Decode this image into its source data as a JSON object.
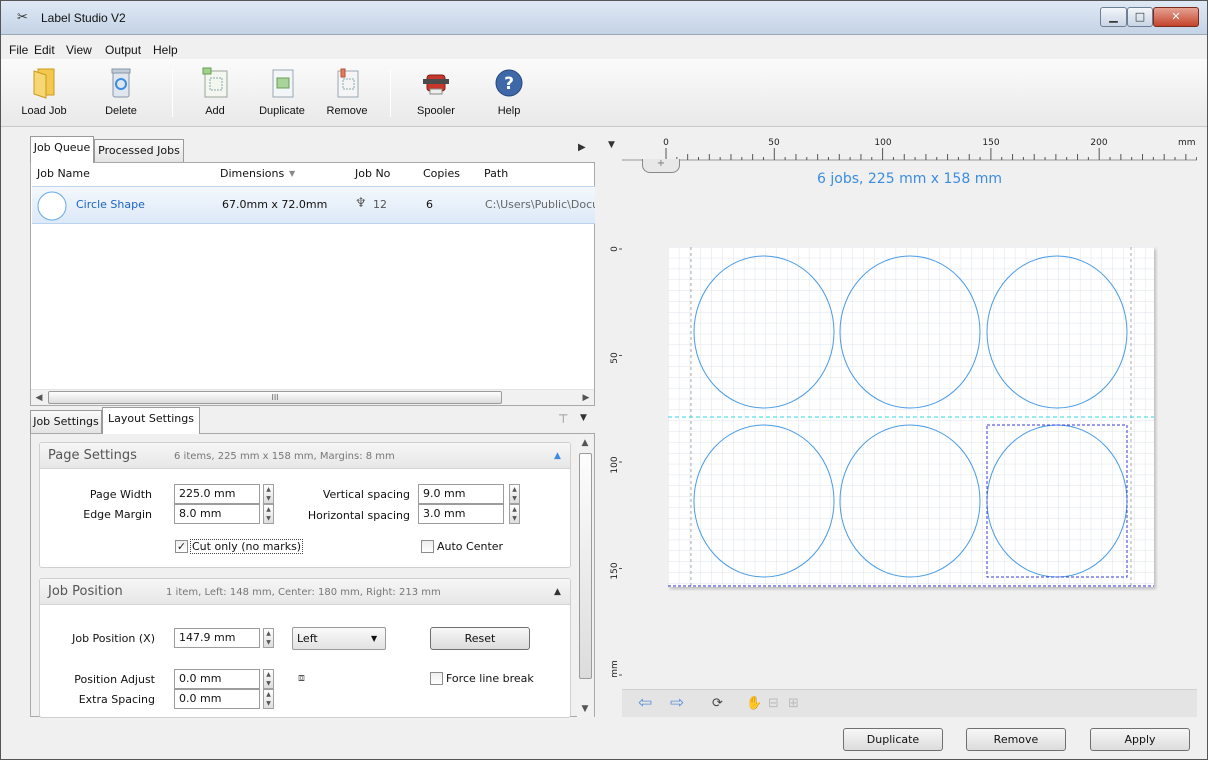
{
  "window": {
    "title": "Label Studio V2",
    "min_glyph": "▁",
    "max_glyph": "□",
    "close_glyph": "✕"
  },
  "menu": [
    {
      "label": "File"
    },
    {
      "label": "Edit"
    },
    {
      "label": "View"
    },
    {
      "label": "Output"
    },
    {
      "label": "Help"
    }
  ],
  "toolbar": {
    "load_job": "Load Job",
    "delete": "Delete",
    "add": "Add",
    "duplicate": "Duplicate",
    "remove": "Remove",
    "spooler": "Spooler",
    "help": "Help"
  },
  "job_tabs": {
    "queue": "Job Queue",
    "processed": "Processed Jobs"
  },
  "job_table": {
    "columns": {
      "name": "Job Name",
      "dimensions": "Dimensions",
      "job_no": "Job No",
      "copies": "Copies",
      "path": "Path"
    },
    "rows": [
      {
        "name": "Circle Shape",
        "dimensions": "67.0mm x 72.0mm",
        "job_no": "12",
        "copies": "6",
        "path": "C:\\Users\\Public\\Docu"
      }
    ],
    "hscroll_grip": "III"
  },
  "settings_tabs": {
    "job": "Job Settings",
    "layout": "Layout Settings"
  },
  "page_settings": {
    "title": "Page Settings",
    "info": "6 items,  225 mm x 158 mm,  Margins: 8 mm",
    "page_width_label": "Page Width",
    "page_width": "225.0 mm",
    "edge_margin_label": "Edge Margin",
    "edge_margin": "8.0 mm",
    "vertical_spacing_label": "Vertical spacing",
    "vertical_spacing": "9.0 mm",
    "horizontal_spacing_label": "Horizontal spacing",
    "horizontal_spacing": "3.0 mm",
    "cut_only_label": "Cut only (no marks)",
    "cut_only": true,
    "auto_center_label": "Auto Center",
    "auto_center": false
  },
  "job_position": {
    "title": "Job Position",
    "info": "1 item, Left: 148 mm, Center: 180 mm, Right: 213 mm",
    "position_x_label": "Job Position (X)",
    "position_x": "147.9 mm",
    "align": "Left",
    "reset": "Reset",
    "position_adjust_label": "Position Adjust",
    "position_adjust": "0.0 mm",
    "extra_spacing_label": "Extra Spacing",
    "extra_spacing": "0.0 mm",
    "force_line_break_label": "Force line break",
    "force_line_break": false
  },
  "preview": {
    "summary": "6 jobs,  225 mm x 158 mm",
    "ruler_top": [
      "0",
      "50",
      "100",
      "150",
      "200",
      "mm"
    ],
    "ruler_left": [
      "0",
      "50",
      "100",
      "150",
      "mm"
    ]
  },
  "footer": {
    "duplicate": "Duplicate",
    "remove": "Remove",
    "apply": "Apply"
  },
  "colors": {
    "accent": "#3b8de0",
    "selection": "#dce9f7",
    "circle": "#4a9be5",
    "guide": "#33d6e6"
  }
}
